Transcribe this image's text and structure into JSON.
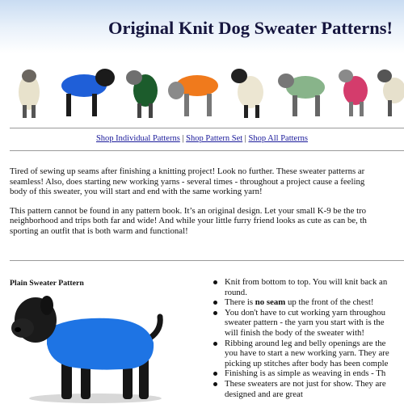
{
  "header": {
    "title": "Original Knit Dog Sweater Patterns!"
  },
  "banner_dogs": [
    {
      "sweater": "cream cable knit",
      "color": "#e8e2cc"
    },
    {
      "sweater": "blue",
      "color": "#1f5fd8"
    },
    {
      "sweater": "dark green",
      "color": "#1c5c2c"
    },
    {
      "sweater": "orange",
      "color": "#f07a1c"
    },
    {
      "sweater": "cream",
      "color": "#ece6d2"
    },
    {
      "sweater": "sage green",
      "color": "#88b48a"
    },
    {
      "sweater": "pink",
      "color": "#d43c6c"
    },
    {
      "sweater": "cream",
      "color": "#e6e0cc"
    }
  ],
  "nav": {
    "links": [
      "Shop Individual Patterns",
      "Shop Pattern Set",
      "Shop All Patterns"
    ],
    "separator": "|"
  },
  "intro": {
    "paragraph1": [
      "Tired of sewing up seams after finishing a knitting project! Look no further. These sweater patterns ar",
      "seamless! Also, does starting new working yarns - several times - throughout a project cause a feeling",
      "body of this sweater, you will start and end with the same working yarn!"
    ],
    "paragraph2": [
      "This pattern cannot be found in any pattern book. It’s an original design. Let your small K-9 be the tro",
      "neighborhood and trips both far and wide! And while your little furry friend looks as cute as can be, th",
      "sporting an outfit that is both warm and functional!"
    ]
  },
  "plain_section": {
    "title": "Plain Sweater Pattern",
    "sweater_color": "#1e74e4",
    "features": [
      [
        "Knit from bottom to top. You will knit back an",
        "round."
      ],
      [
        "There is ",
        "no seam",
        " up the front of the chest!"
      ],
      [
        "You don't have to cut working yarn throughou",
        "sweater pattern - the yarn you start with is the",
        "will finish the body of the sweater with!"
      ],
      [
        "Ribbing around leg and belly openings are the",
        "you have to start a new working yarn. They are",
        "picking up stitches after body has been comple"
      ],
      [
        "Finishing is as simple as weaving in ends - Th"
      ],
      [
        "These sweaters are not just for show. They are",
        "designed and are great"
      ]
    ]
  }
}
